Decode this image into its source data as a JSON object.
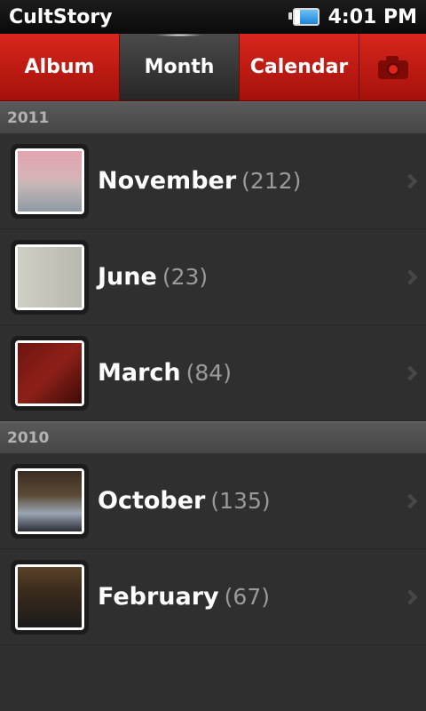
{
  "status_bar": {
    "app_title": "CultStory",
    "time": "4:01 PM",
    "battery_level": 0.75
  },
  "tabs": [
    {
      "label": "Album",
      "active": false
    },
    {
      "label": "Month",
      "active": true
    },
    {
      "label": "Calendar",
      "active": false
    },
    {
      "icon": "camera-icon"
    }
  ],
  "sections": [
    {
      "year": "2011",
      "items": [
        {
          "month": "November",
          "count": "(212)"
        },
        {
          "month": "June",
          "count": "(23)"
        },
        {
          "month": "March",
          "count": "(84)"
        }
      ]
    },
    {
      "year": "2010",
      "items": [
        {
          "month": "October",
          "count": "(135)"
        },
        {
          "month": "February",
          "count": "(67)"
        }
      ]
    }
  ],
  "colors": {
    "tab_red": "#c91d14",
    "tab_active": "#333333",
    "background": "#2f2f2f",
    "count_gray": "#9a9a9a"
  }
}
